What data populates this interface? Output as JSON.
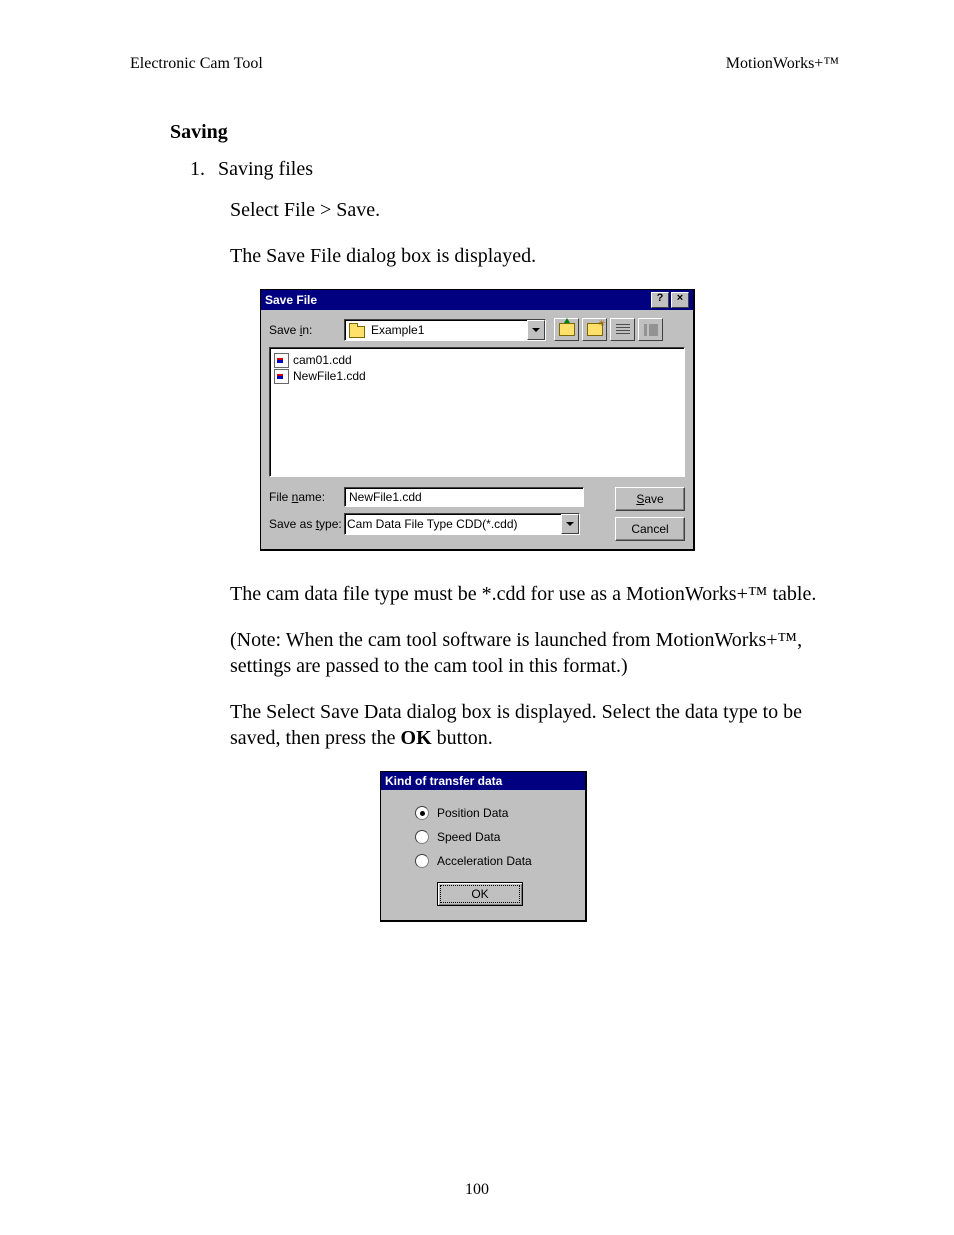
{
  "header": {
    "left": "Electronic Cam Tool",
    "right": "MotionWorks+™"
  },
  "section_title": "Saving",
  "list_item": {
    "num": "1.",
    "text": "Saving files"
  },
  "para1": "Select File > Save.",
  "para2": "The Save File dialog box is displayed.",
  "save_dialog": {
    "title": "Save File",
    "help_glyph": "?",
    "close_glyph": "×",
    "save_in_label": "Save in:",
    "save_in_value": "Example1",
    "files": [
      "cam01.cdd",
      "NewFile1.cdd"
    ],
    "file_name_label": "File name:",
    "file_name_value": "NewFile1.cdd",
    "type_label": "Save as type:",
    "type_value": "Cam Data File Type CDD(*.cdd)",
    "save_btn_pre": "S",
    "save_btn_post": "ave",
    "cancel_btn": "Cancel"
  },
  "para3": "The cam data file type must be *.cdd for use as a MotionWorks+™ table.",
  "para4": "(Note:  When the cam tool software is launched from MotionWorks+™, settings are passed to the cam tool in this format.)",
  "para5a": "The Select Save Data dialog box is displayed.  Select the data type to be saved, then press the ",
  "para5b": "OK",
  "para5c": " button.",
  "kind_dialog": {
    "title": "Kind of transfer data",
    "options": [
      {
        "label": "Position Data",
        "selected": true
      },
      {
        "label": "Speed Data",
        "selected": false
      },
      {
        "label": "Acceleration Data",
        "selected": false
      }
    ],
    "ok": "OK"
  },
  "page_num": "100"
}
